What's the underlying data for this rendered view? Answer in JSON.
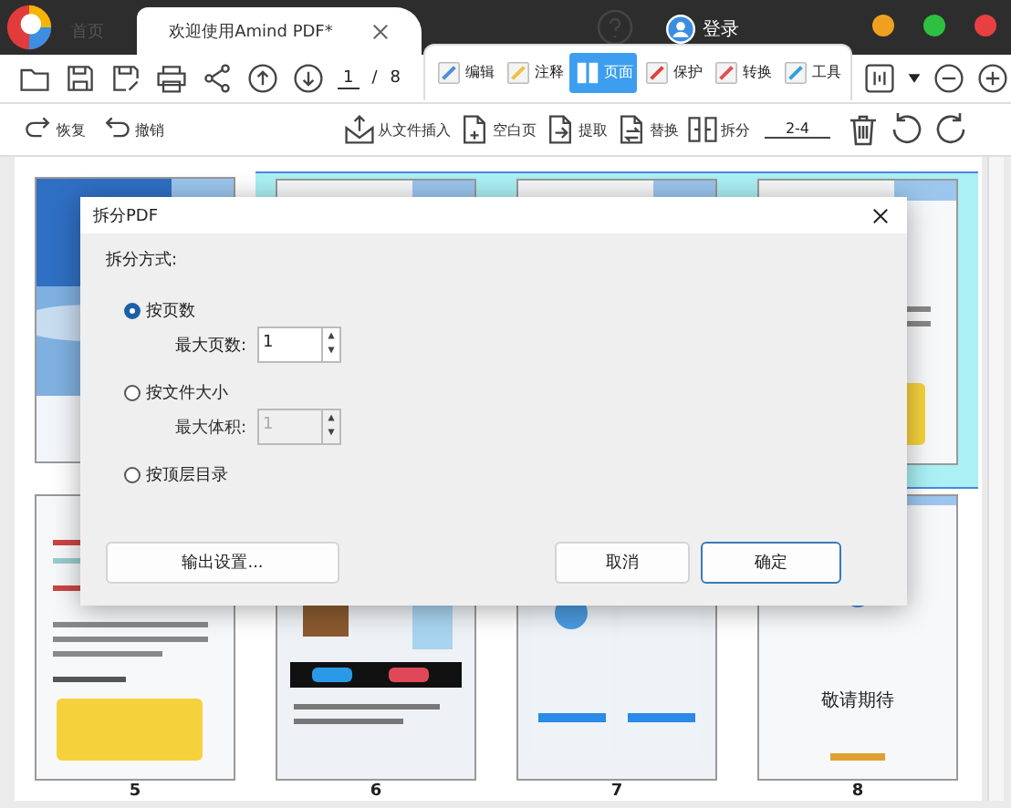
{
  "window": {
    "tabs": [
      {
        "label": "首页",
        "selected": false
      },
      {
        "label": "欢迎使用Amind PDF*",
        "selected": true
      }
    ],
    "login": "登录"
  },
  "toolbar": {
    "page_current": "1",
    "page_separator": "/",
    "page_total": "8",
    "ribbon": [
      {
        "label": "编辑",
        "selected": false
      },
      {
        "label": "注释",
        "selected": false
      },
      {
        "label": "页面",
        "selected": true
      },
      {
        "label": "保护",
        "selected": false
      },
      {
        "label": "转换",
        "selected": false
      },
      {
        "label": "工具",
        "selected": false
      }
    ]
  },
  "actions": {
    "history": [
      "恢复",
      "撤销"
    ],
    "page_tools": [
      "从文件插入",
      "空白页",
      "提取",
      "替换",
      "拆分"
    ],
    "range": "2-4"
  },
  "pages": [
    {
      "kind": "photo",
      "selected": false
    },
    {
      "kind": "doc",
      "selected": true
    },
    {
      "kind": "doc",
      "selected": true
    },
    {
      "kind": "doc",
      "selected": true
    },
    {
      "kind": "doc",
      "selected": false,
      "label": "5"
    },
    {
      "kind": "gallery",
      "selected": false,
      "label": "6"
    },
    {
      "kind": "phones",
      "selected": false,
      "label": "7"
    },
    {
      "kind": "end",
      "selected": false,
      "label": "8",
      "text": "敬请期待"
    }
  ],
  "dialog": {
    "title": "拆分PDF",
    "section": "拆分方式:",
    "options": [
      {
        "label": "按页数",
        "selected": true,
        "field_label": "最大页数:",
        "value": "1",
        "disabled": false
      },
      {
        "label": "按文件大小",
        "selected": false,
        "field_label": "最大体积:",
        "value": "1",
        "disabled": true
      },
      {
        "label": "按顶层目录",
        "selected": false
      }
    ],
    "output_button": "输出设置...",
    "cancel_button": "取消",
    "ok_button": "确定"
  }
}
